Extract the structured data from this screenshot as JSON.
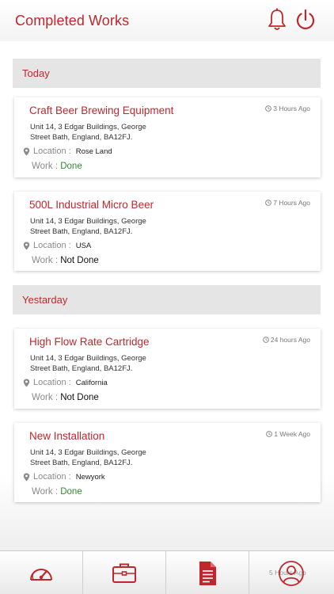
{
  "header": {
    "title": "Completed Works",
    "bell_icon": "bell-icon",
    "power_icon": "power-icon"
  },
  "sections": [
    {
      "label": "Today",
      "cards": [
        {
          "title": "Craft Beer Brewing Equipment",
          "time": "3 Hours Ago",
          "address_line1": "Unit 14, 3 Edgar Buildings, George",
          "address_line2": "Street Bath, England, BA12FJ.",
          "location_label": "Location :",
          "location": "Rose Land",
          "work_label": "Work :",
          "work_status": "Done"
        },
        {
          "title": "500L Industrial Micro Beer",
          "time": "7 Hours Ago",
          "address_line1": "Unit 14, 3 Edgar Buildings, George",
          "address_line2": "Street Bath, England, BA12FJ.",
          "location_label": "Location :",
          "location": "USA",
          "work_label": "Work :",
          "work_status": "Not Done"
        }
      ]
    },
    {
      "label": "Yestarday",
      "cards": [
        {
          "title": "High Flow Rate Cartridge",
          "time": "24 hours Ago",
          "address_line1": "Unit 14, 3 Edgar Buildings, George",
          "address_line2": "Street Bath, England, BA12FJ.",
          "location_label": "Location :",
          "location": "California",
          "work_label": "Work :",
          "work_status": "Not Done"
        },
        {
          "title": "New Installation",
          "time": "1 Week Ago",
          "address_line1": "Unit 14, 3 Edgar Buildings, George",
          "address_line2": "Street Bath, England, BA12FJ.",
          "location_label": "Location :",
          "location": "Newyork",
          "work_label": "Work :",
          "work_status": "Done"
        }
      ]
    }
  ],
  "tabbar": {
    "tabs": [
      "speedometer-icon",
      "briefcase-icon",
      "document-icon",
      "user-icon"
    ],
    "ghost_time": "5 Hours Ago"
  },
  "colors": {
    "accent": "#c0272d",
    "done": "#2e8b2e",
    "section_bg": "#e5e5e5"
  }
}
